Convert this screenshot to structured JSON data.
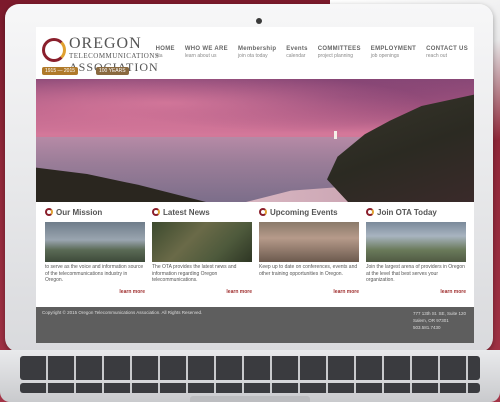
{
  "site": {
    "logo": {
      "line1": "OREGON",
      "line2": "TELECOMMUNICATIONS",
      "line3": "ASSOCIATION",
      "years": "1915 — 2015",
      "anniversary": "100 YEARS"
    },
    "nav": [
      {
        "title": "HOME",
        "sub": "ota"
      },
      {
        "title": "WHO WE ARE",
        "sub": "learn about us"
      },
      {
        "title": "Membership",
        "sub": "join ota today"
      },
      {
        "title": "Events",
        "sub": "calendar"
      },
      {
        "title": "COMMITTEES",
        "sub": "project planning"
      },
      {
        "title": "EMPLOYMENT",
        "sub": "job openings"
      },
      {
        "title": "CONTACT US",
        "sub": "reach out"
      }
    ],
    "columns": [
      {
        "title": "Our Mission",
        "text": "to serve as the voice and information source of the telecommunications industry in Oregon.",
        "more": "learn more"
      },
      {
        "title": "Latest News",
        "text": "The OTA provides the latest news and information regarding Oregon telecommunications.",
        "more": "learn more"
      },
      {
        "title": "Upcoming Events",
        "text": "Keep up to date on conferences, events and other training opportunities in Oregon.",
        "more": "learn more"
      },
      {
        "title": "Join OTA Today",
        "text": "Join the largest arena of providers in Oregon at the level that best serves your organization.",
        "more": "learn more"
      }
    ],
    "footer": {
      "copyright": "Copyright © 2015 Oregon Telecommunications Association. All Rights Reserved.",
      "address1": "777 13th St. SE, Suite 120",
      "address2": "Salem, OR 97301",
      "phone": "503.581.7430"
    }
  },
  "colors": {
    "brand_red": "#8a1f2c",
    "brand_gold": "#e0a030",
    "footer_bg": "#5e5e5e",
    "background": "#93283a"
  }
}
